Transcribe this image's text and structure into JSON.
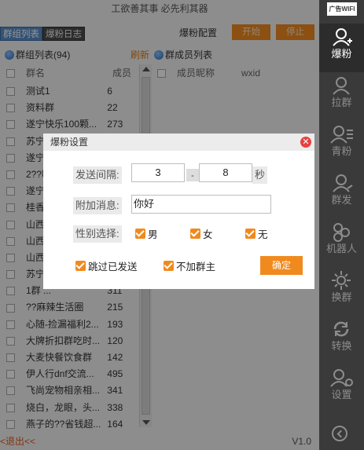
{
  "window": {
    "title": "工欲善其事 必先利其器",
    "version": "V1.0",
    "logout": "<退出<<"
  },
  "tabs": [
    {
      "label": "群组列表"
    },
    {
      "label": "爆粉日志"
    }
  ],
  "toolbar": {
    "config_label": "爆粉配置",
    "start_label": "开始",
    "stop_label": "停止"
  },
  "group_panel": {
    "title": "群组列表(94)",
    "refresh": "刷新",
    "col_name": "群名",
    "col_members": "成员"
  },
  "member_panel": {
    "title": "群成员列表",
    "col_nick": "成员昵称",
    "col_wxid": "wxid"
  },
  "groups": [
    {
      "name": "测试1",
      "count": "6"
    },
    {
      "name": "资料群",
      "count": "22"
    },
    {
      "name": "遂宁快乐100颗...",
      "count": "273"
    },
    {
      "name": "苏宁...",
      "count": ""
    },
    {
      "name": "遂宁...",
      "count": ""
    },
    {
      "name": "2??哦...",
      "count": ""
    },
    {
      "name": "遂宁...",
      "count": ""
    },
    {
      "name": "桂香...",
      "count": ""
    },
    {
      "name": "山西...",
      "count": ""
    },
    {
      "name": "山西...",
      "count": ""
    },
    {
      "name": "山西...",
      "count": ""
    },
    {
      "name": "苏宁...",
      "count": ""
    },
    {
      "name": "1群 ...",
      "count": "311"
    },
    {
      "name": "??麻辣生活圈",
      "count": "215"
    },
    {
      "name": "心随-捡漏福利2...",
      "count": "193"
    },
    {
      "name": "大牌折扣群吃时...",
      "count": "120"
    },
    {
      "name": "大麦快餐饮食群",
      "count": "142"
    },
    {
      "name": "伊人行dnf交流...",
      "count": "495"
    },
    {
      "name": "飞尚宠物相亲相...",
      "count": "341"
    },
    {
      "name": "烧白，龙眼，头...",
      "count": "338"
    },
    {
      "name": "燕子的??省钱超...",
      "count": "164"
    }
  ],
  "sidebar": {
    "logo": "广告WIFI",
    "items": [
      {
        "label": "爆粉",
        "icon": "add-user-icon"
      },
      {
        "label": "拉群",
        "icon": "pull-group-icon"
      },
      {
        "label": "青粉",
        "icon": "clean-fans-icon"
      },
      {
        "label": "群发",
        "icon": "broadcast-icon"
      },
      {
        "label": "机器人",
        "icon": "robot-icon"
      },
      {
        "label": "换群",
        "icon": "switch-group-icon"
      },
      {
        "label": "转换",
        "icon": "refresh-icon"
      },
      {
        "label": "设置",
        "icon": "settings-icon"
      }
    ]
  },
  "dialog": {
    "title": "爆粉设置",
    "interval_label": "发送间隔:",
    "interval_min": "3",
    "interval_sep": "-",
    "interval_max": "8",
    "interval_unit": "秒",
    "message_label": "附加消息:",
    "message_value": "你好",
    "gender_label": "性别选择:",
    "gender_male": "男",
    "gender_female": "女",
    "gender_none": "无",
    "skip_sent": "跳过已发送",
    "no_owner": "不加群主",
    "confirm": "确定"
  },
  "colors": {
    "accent": "#f08a1f",
    "sidebar": "#3a3a3a",
    "tab_active": "#5a8ec9",
    "close": "#e84141"
  }
}
